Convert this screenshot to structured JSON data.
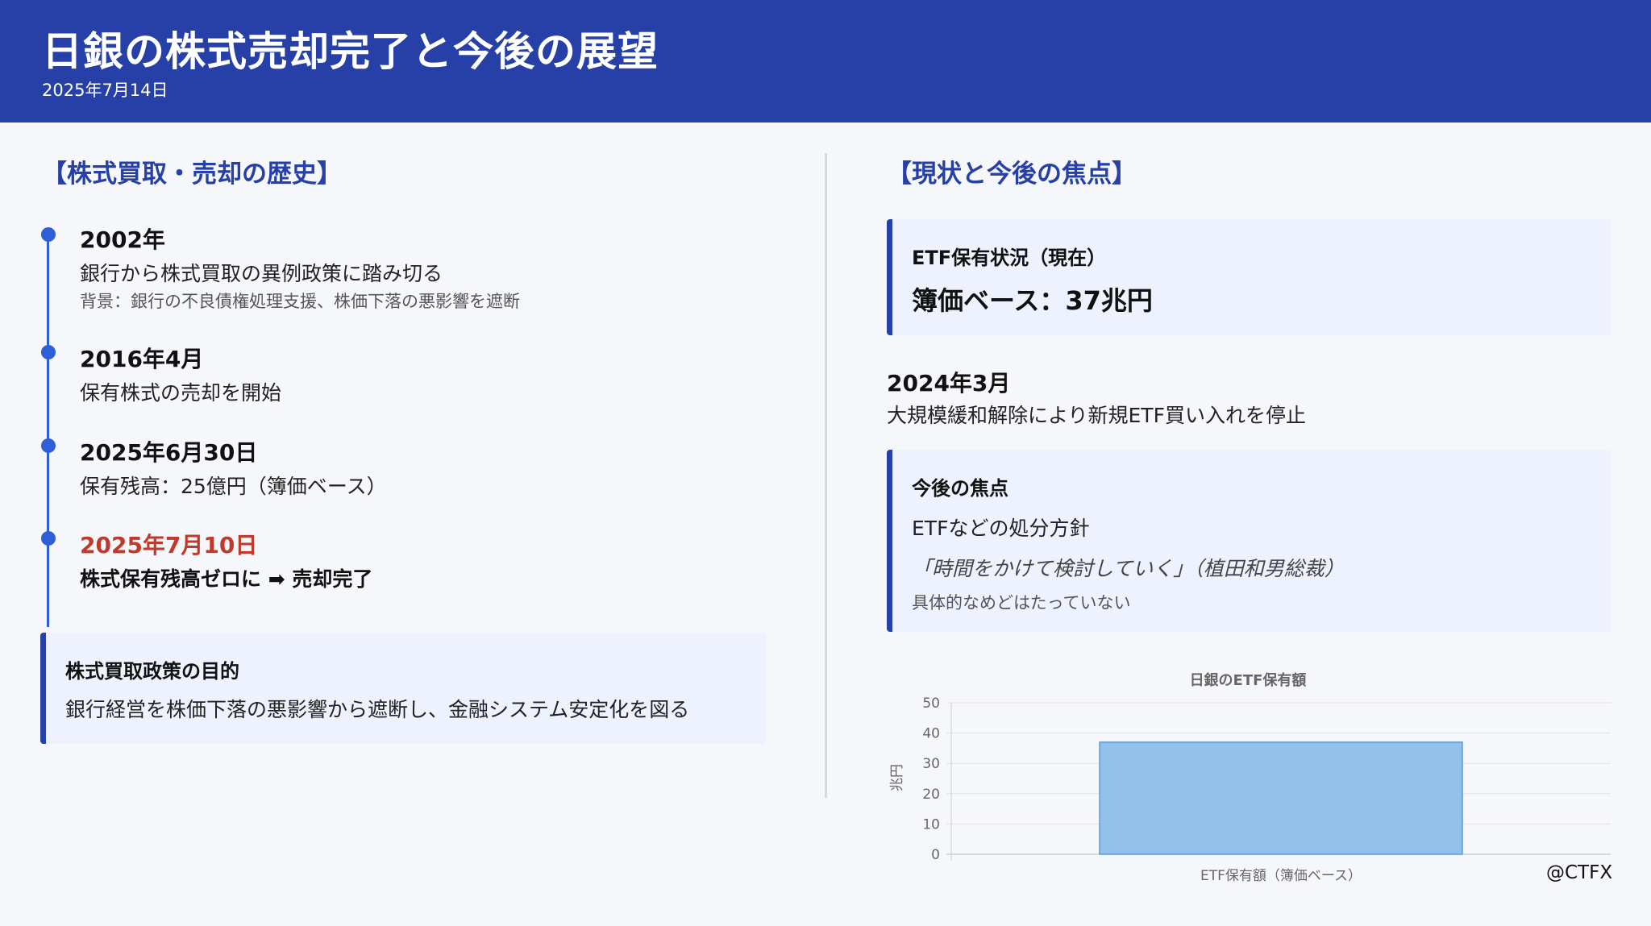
{
  "header": {
    "title": "日銀の株式売却完了と今後の展望",
    "date": "2025年7月14日"
  },
  "left": {
    "section_title": "【株式買取・売却の歴史】",
    "timeline": [
      {
        "date": "2002年",
        "desc": "銀行から株式買取の異例政策に踏み切る",
        "note": "背景：銀行の不良債権処理支援、株価下落の悪影響を遮断"
      },
      {
        "date": "2016年4月",
        "desc": "保有株式の売却を開始"
      },
      {
        "date": "2025年6月30日",
        "desc": "保有残高：25億円（簿価ベース）"
      },
      {
        "date": "2025年7月10日",
        "desc": "株式保有残高ゼロに ➡ 売却完了"
      }
    ],
    "purpose_box": {
      "title": "株式買取政策の目的",
      "text": "銀行経営を株価下落の悪影響から遮断し、金融システム安定化を図る"
    }
  },
  "right": {
    "section_title": "【現状と今後の焦点】",
    "etf_box": {
      "title": "ETF保有状況（現在）",
      "value": "簿価ベース：37兆円"
    },
    "event": {
      "date": "2024年3月",
      "text": "大規模緩和解除により新規ETF買い入れを停止"
    },
    "focus_box": {
      "title": "今後の焦点",
      "text": "ETFなどの処分方針",
      "quote": "「時間をかけて検討していく」（植田和男総裁）",
      "note": "具体的なめどはたっていない"
    }
  },
  "chart_data": {
    "type": "bar",
    "title": "日銀のETF保有額",
    "categories": [
      "ETF保有額（簿価ベース）"
    ],
    "values": [
      37
    ],
    "ylabel": "兆円",
    "xlabel": "",
    "ylim": [
      0,
      50
    ],
    "yticks": [
      0,
      10,
      20,
      30,
      40,
      50
    ],
    "grid": true,
    "colors": {
      "bar_fill": "#94c0ec",
      "bar_stroke": "#5b9bd5"
    }
  },
  "credit": "@CTFX",
  "colors": {
    "header_bg": "#2640a8",
    "accent": "#2f5fd6",
    "highlight_red": "#c0392b",
    "box_bg": "#eef2ff"
  }
}
